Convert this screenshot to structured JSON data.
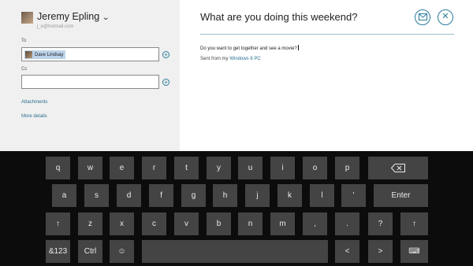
{
  "account": {
    "name": "Jeremy Epling",
    "email": "j_e@hotmail.com"
  },
  "compose": {
    "to_label": "To",
    "to_recipient": "Dave Lindsay",
    "cc_label": "Cc",
    "attachments_label": "Attachments",
    "more_details_label": "More details",
    "subject": "What are you doing this weekend?",
    "body": "Do you want to get together and see a movie?",
    "signature_prefix": "Sent from my ",
    "signature_link": "Windows 8 PC"
  },
  "icons": {
    "send": "send-icon",
    "close": "close-icon",
    "add": "plus-icon"
  },
  "colors": {
    "accent": "#2a7c9c",
    "left_pane_bg": "#f0f0f0",
    "keyboard_bg": "#0c0c0c",
    "key_bg": "#444444"
  },
  "keyboard": {
    "rows": [
      [
        "q",
        "w",
        "e",
        "r",
        "t",
        "y",
        "u",
        "i",
        "o",
        "p",
        "⌫"
      ],
      [
        "a",
        "s",
        "d",
        "f",
        "g",
        "h",
        "j",
        "k",
        "l",
        "'",
        "Enter"
      ],
      [
        "↑",
        "z",
        "x",
        "c",
        "v",
        "b",
        "n",
        "m",
        ",",
        ".",
        "?",
        "↑"
      ],
      [
        "&123",
        "Ctrl",
        "☺",
        "",
        "<",
        ">",
        "⌨"
      ]
    ]
  }
}
